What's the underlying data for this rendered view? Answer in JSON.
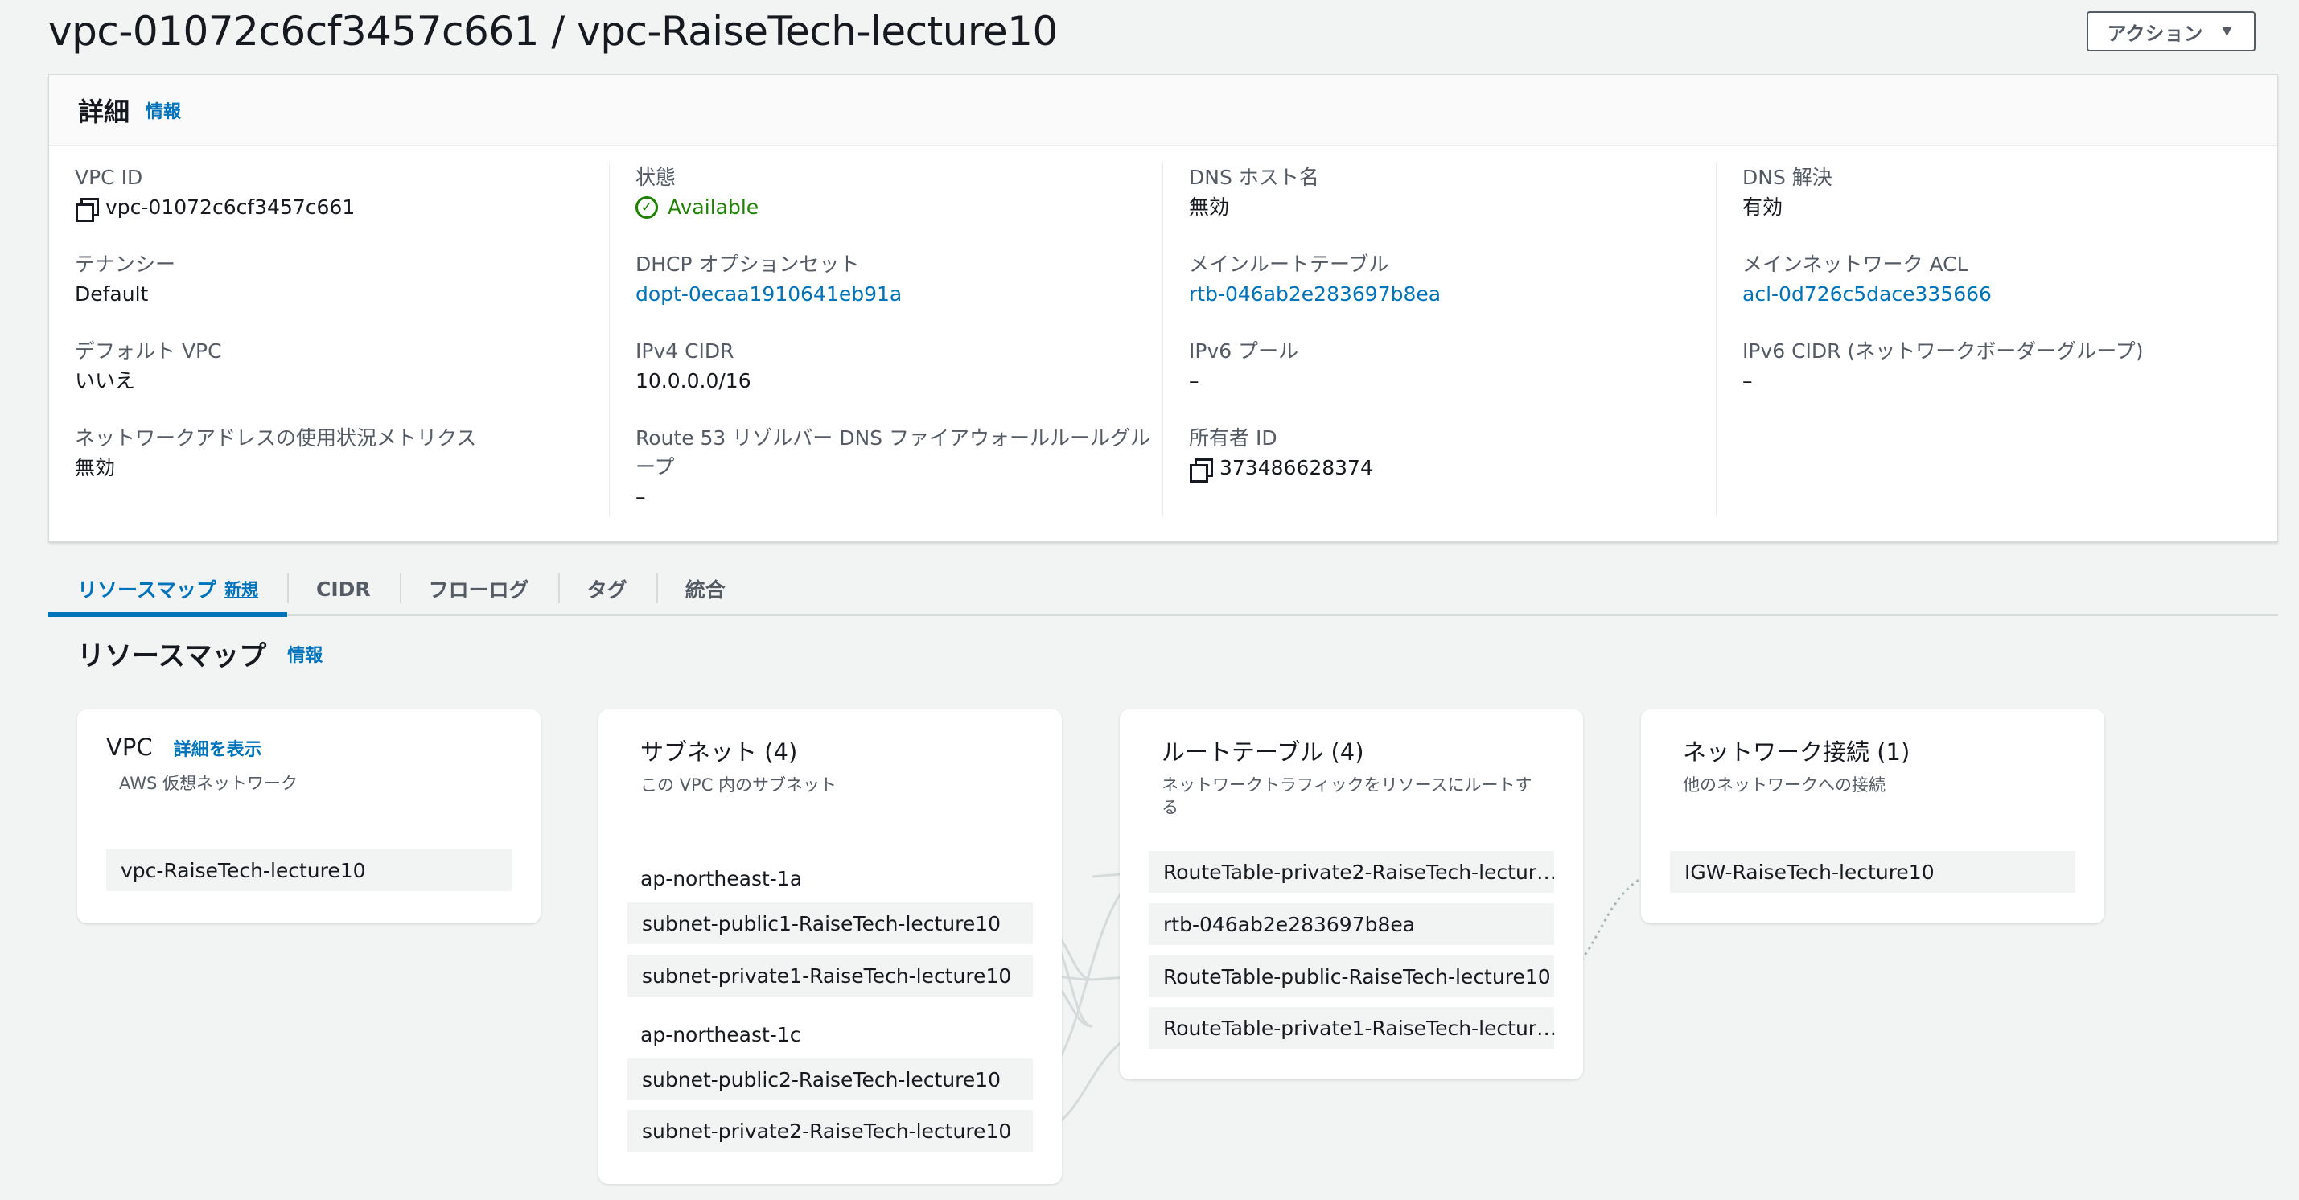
{
  "header": {
    "title": "vpc-01072c6cf3457c661 / vpc-RaiseTech-lecture10",
    "action_label": "アクション"
  },
  "details": {
    "heading": "詳細",
    "info": "情報",
    "vpc_id": {
      "label": "VPC ID",
      "value": "vpc-01072c6cf3457c661"
    },
    "state": {
      "label": "状態",
      "value": "Available"
    },
    "dns_hostnames": {
      "label": "DNS ホスト名",
      "value": "無効"
    },
    "dns_resolution": {
      "label": "DNS 解決",
      "value": "有効"
    },
    "tenancy": {
      "label": "テナンシー",
      "value": "Default"
    },
    "dhcp": {
      "label": "DHCP オプションセット",
      "value": "dopt-0ecaa1910641eb91a"
    },
    "main_route_table": {
      "label": "メインルートテーブル",
      "value": "rtb-046ab2e283697b8ea"
    },
    "main_acl": {
      "label": "メインネットワーク ACL",
      "value": "acl-0d726c5dace335666"
    },
    "default_vpc": {
      "label": "デフォルト VPC",
      "value": "いいえ"
    },
    "ipv4_cidr": {
      "label": "IPv4 CIDR",
      "value": "10.0.0.0/16"
    },
    "ipv6_pool": {
      "label": "IPv6 プール",
      "value": "–"
    },
    "ipv6_cidr": {
      "label": "IPv6 CIDR (ネットワークボーダーグループ)",
      "value": "–"
    },
    "net_metrics": {
      "label": "ネットワークアドレスの使用状況メトリクス",
      "value": "無効"
    },
    "route53": {
      "label_line1": "Route 53 リゾルバー DNS ファイアウォールルールグル",
      "label_line2": "ープ",
      "value": "–"
    },
    "owner_id": {
      "label": "所有者 ID",
      "value": "373486628374"
    }
  },
  "tabs": {
    "resource_map": "リソースマップ",
    "resource_map_badge": "新規",
    "cidr": "CIDR",
    "flow_logs": "フローログ",
    "tags": "タグ",
    "integrations": "統合"
  },
  "resource_map": {
    "title": "リソースマップ",
    "info": "情報",
    "vpc_card": {
      "title": "VPC",
      "link": "詳細を表示",
      "subtitle": "AWS 仮想ネットワーク",
      "items": [
        "vpc-RaiseTech-lecture10"
      ]
    },
    "subnet_card": {
      "title": "サブネット (4)",
      "subtitle": "この VPC 内のサブネット",
      "az1": "ap-northeast-1a",
      "az1_items": [
        "subnet-public1-RaiseTech-lecture10",
        "subnet-private1-RaiseTech-lecture10"
      ],
      "az2": "ap-northeast-1c",
      "az2_items": [
        "subnet-public2-RaiseTech-lecture10",
        "subnet-private2-RaiseTech-lecture10"
      ]
    },
    "route_card": {
      "title": "ルートテーブル (4)",
      "subtitle": "ネットワークトラフィックをリソースにルートする",
      "items": [
        "RouteTable-private2-RaiseTech-lectur…",
        "rtb-046ab2e283697b8ea",
        "RouteTable-public-RaiseTech-lecture10",
        "RouteTable-private1-RaiseTech-lectur…"
      ]
    },
    "network_card": {
      "title": "ネットワーク接続 (1)",
      "subtitle": "他のネットワークへの接続",
      "items": [
        "IGW-RaiseTech-lecture10"
      ]
    }
  },
  "colors": {
    "link": "#0073bb",
    "success": "#1d8102",
    "background": "#f2f3f3"
  }
}
